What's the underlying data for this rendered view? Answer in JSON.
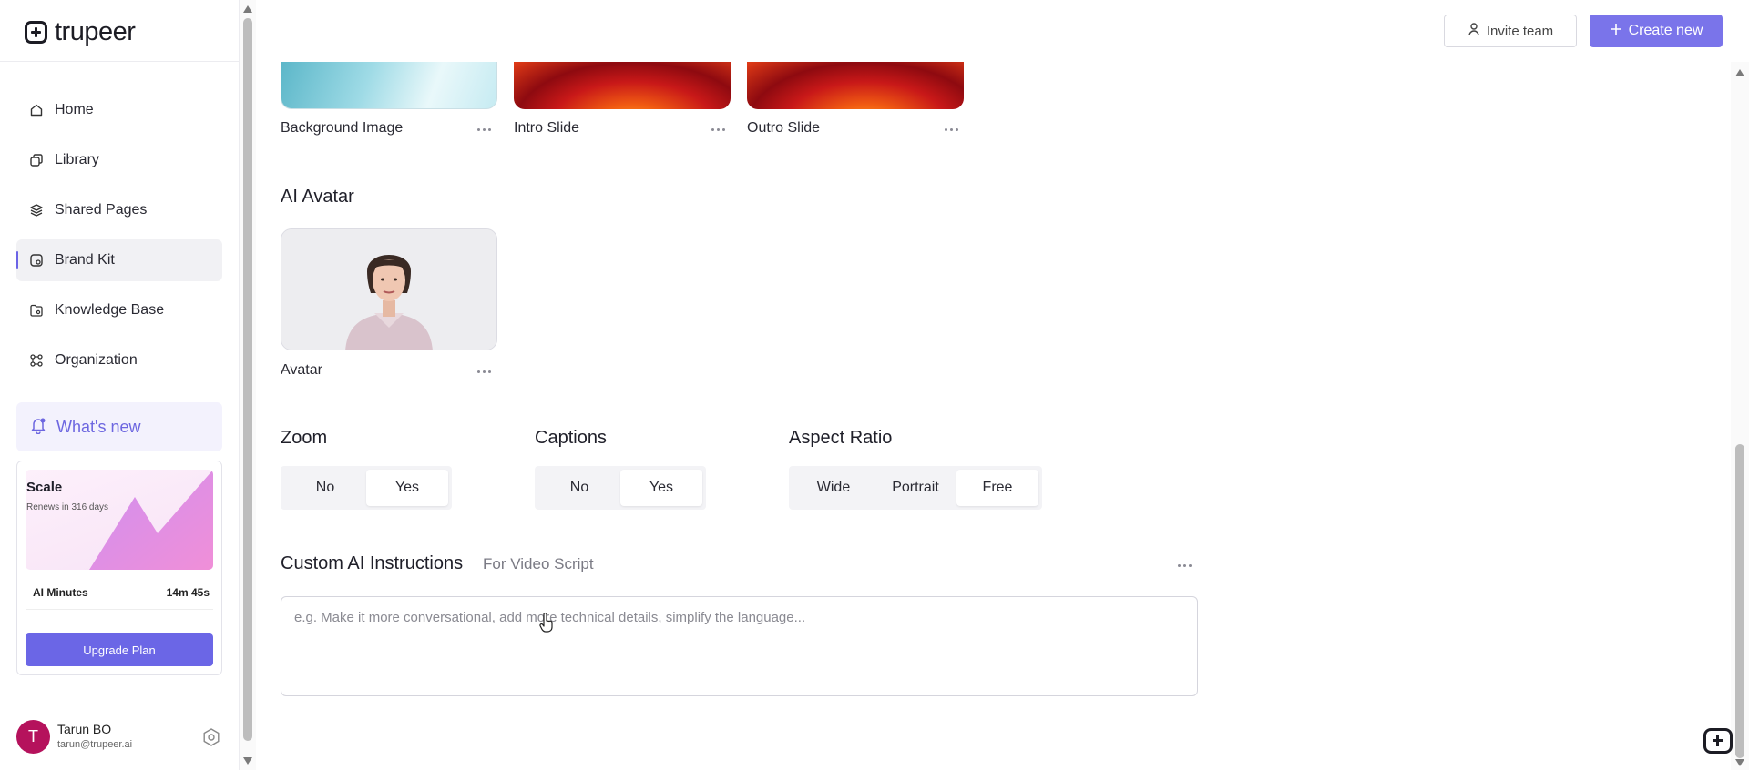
{
  "app": {
    "logo_text": "trupeer"
  },
  "sidebar": {
    "items": [
      {
        "label": "Home",
        "icon": "home-icon"
      },
      {
        "label": "Library",
        "icon": "library-icon"
      },
      {
        "label": "Shared Pages",
        "icon": "layers-icon"
      },
      {
        "label": "Brand Kit",
        "icon": "brand-kit-icon",
        "active": true
      },
      {
        "label": "Knowledge Base",
        "icon": "knowledge-base-icon"
      },
      {
        "label": "Organization",
        "icon": "organization-icon"
      }
    ],
    "whats_new": "What's new",
    "plan": {
      "name": "Scale",
      "renews": "Renews in 316 days",
      "minutes_label": "AI Minutes",
      "minutes_value": "14m 45s",
      "upgrade_label": "Upgrade Plan"
    },
    "user": {
      "initial": "T",
      "name": "Tarun BO",
      "email": "tarun@trupeer.ai"
    }
  },
  "header": {
    "invite_label": "Invite team",
    "create_label": "Create new"
  },
  "assets": [
    {
      "label": "Background Image"
    },
    {
      "label": "Intro Slide"
    },
    {
      "label": "Outro Slide"
    }
  ],
  "ai_avatar": {
    "title": "AI Avatar",
    "label": "Avatar"
  },
  "zoom": {
    "title": "Zoom",
    "options": [
      "No",
      "Yes"
    ],
    "selected": "Yes"
  },
  "captions": {
    "title": "Captions",
    "options": [
      "No",
      "Yes"
    ],
    "selected": "Yes"
  },
  "aspect_ratio": {
    "title": "Aspect Ratio",
    "options": [
      "Wide",
      "Portrait",
      "Free"
    ],
    "selected": "Free"
  },
  "custom_ai": {
    "title": "Custom AI Instructions",
    "subtitle": "For Video Script",
    "placeholder": "e.g. Make it more conversational, add more technical details, simplify the language..."
  },
  "colors": {
    "accent": "#6b66e6",
    "avatar_bg": "#b5125c"
  }
}
